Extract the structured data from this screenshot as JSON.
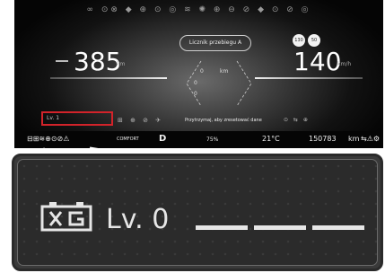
{
  "cluster": {
    "top_indicators": "∞ ⊙⊗ ◆ ⊕ ⊙ ◎ ≋ ✺ ⊕ ⊖ ⊘ ◆ ⊙ ⊘ ◎",
    "trip_pill": "Licznik przebiegu A",
    "left_gauge_value": "385",
    "left_gauge_unit": "km",
    "right_gauge_value": "140",
    "right_gauge_unit": "km/h",
    "adas_badges": [
      "130",
      "50"
    ],
    "center_values": [
      "0",
      "0",
      "0"
    ],
    "center_unit": "km",
    "hint_text": "Przytrzymaj, aby zresetować dane",
    "mode_label": "Lv. 1"
  },
  "status_bar": {
    "gear": "D",
    "fuel": "75%",
    "temperature": "21°C",
    "odometer": "150783",
    "odometer_unit": "km",
    "left_icons": "⊟⊞≋⊕⊙⊘⚠",
    "right_icons": "⇆⚠⚙",
    "mode_badge": "COMFORT"
  },
  "zoom": {
    "icon": "battery-x-icon",
    "level_label": "Lv. 0"
  },
  "colors": {
    "highlight": "#d2232a",
    "text": "#e6e6e6"
  }
}
